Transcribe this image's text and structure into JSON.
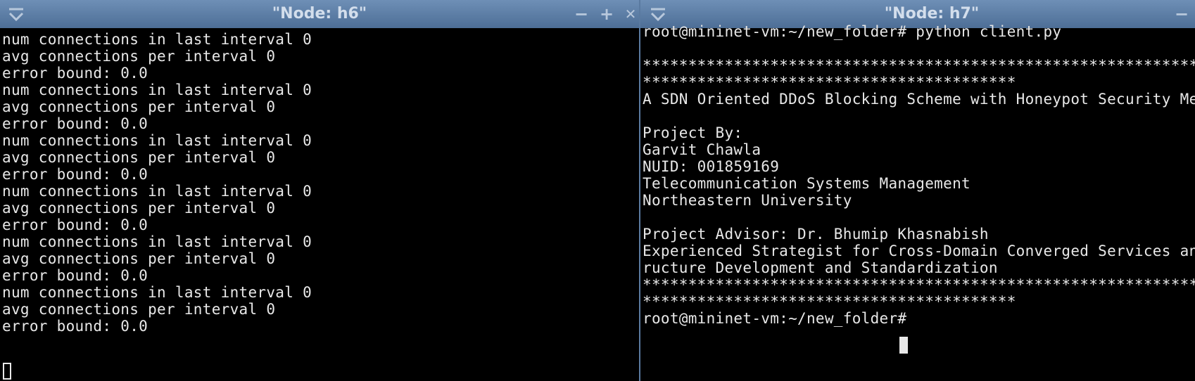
{
  "window_left": {
    "title": "\"Node: h6\"",
    "controls": {
      "minimize": "−",
      "maximize": "+",
      "close": "✕"
    },
    "lines": [
      "num connections in last interval 0",
      "avg connections per interval 0",
      "error bound: 0.0",
      "num connections in last interval 0",
      "avg connections per interval 0",
      "error bound: 0.0",
      "num connections in last interval 0",
      "avg connections per interval 0",
      "error bound: 0.0",
      "num connections in last interval 0",
      "avg connections per interval 0",
      "error bound: 0.0",
      "num connections in last interval 0",
      "avg connections per interval 0",
      "error bound: 0.0",
      "num connections in last interval 0",
      "avg connections per interval 0",
      "error bound: 0.0"
    ]
  },
  "window_right": {
    "title": "\"Node: h7\"",
    "controls": {
      "minimize": "−"
    },
    "lines": [
      "root@mininet-vm:~/new_folder# python client.py",
      "",
      "**************************************************************",
      "*****************************************",
      "A SDN Oriented DDoS Blocking Scheme with Honeypot Security Mechanism",
      "",
      "Project By:",
      "Garvit Chawla",
      "NUID: 001859169",
      "Telecommunication Systems Management",
      "Northeastern University",
      "",
      "Project Advisor: Dr. Bhumip Khasnabish",
      "Experienced Strategist for Cross-Domain Converged Services and Infrast",
      "ructure Development and Standardization",
      "**************************************************************",
      "*****************************************",
      "root@mininet-vm:~/new_folder# "
    ]
  }
}
